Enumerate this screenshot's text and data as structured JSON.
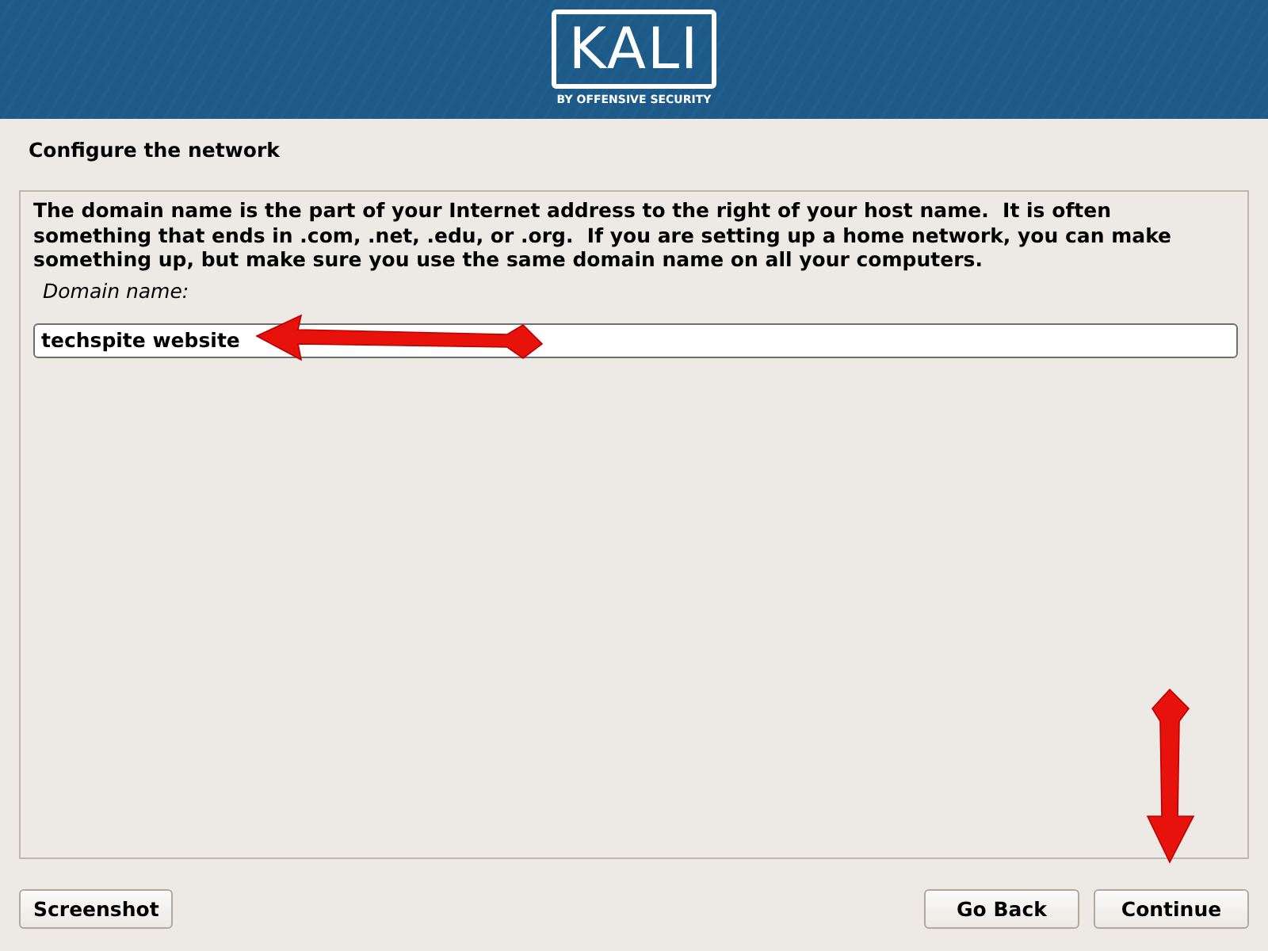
{
  "header": {
    "logo_text": "KALI",
    "logo_tagline": "BY OFFENSIVE SECURITY"
  },
  "page_title": "Configure the network",
  "description": "The domain name is the part of your Internet address to the right of your host name.  It is often something that ends in .com, .net, .edu, or .org.  If you are setting up a home network, you can make something up, but make sure you use the same domain name on all your computers.",
  "field": {
    "label": "Domain name:",
    "value": "techspite website"
  },
  "buttons": [
    {
      "label": "Screenshot",
      "kind": "left"
    },
    {
      "label": "Go Back",
      "kind": "right"
    },
    {
      "label": "Continue",
      "kind": "right"
    }
  ]
}
